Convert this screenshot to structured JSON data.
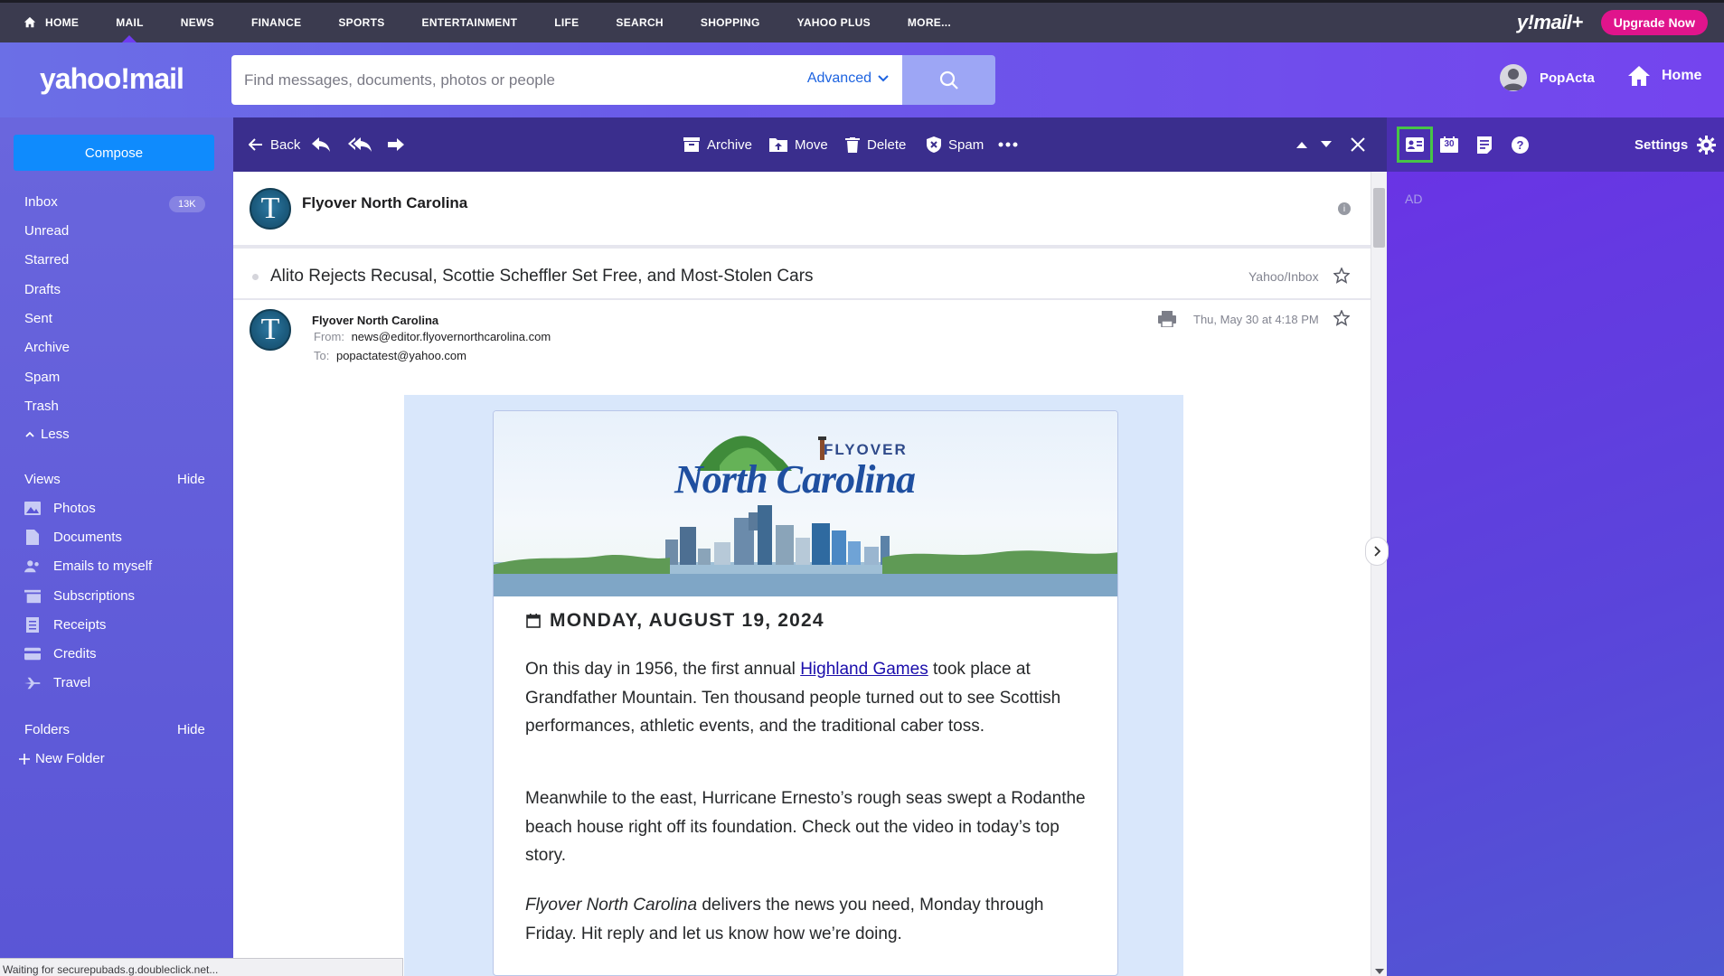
{
  "topnav": {
    "items": [
      {
        "label": "HOME",
        "icon": "home-icon"
      },
      {
        "label": "MAIL",
        "active": true
      },
      {
        "label": "NEWS"
      },
      {
        "label": "FINANCE"
      },
      {
        "label": "SPORTS"
      },
      {
        "label": "ENTERTAINMENT"
      },
      {
        "label": "LIFE"
      },
      {
        "label": "SEARCH"
      },
      {
        "label": "SHOPPING"
      },
      {
        "label": "YAHOO PLUS"
      },
      {
        "label": "MORE..."
      }
    ],
    "mailplus_logo": "y!mail+",
    "upgrade_label": "Upgrade Now"
  },
  "header": {
    "logo": "yahoo!mail",
    "search_placeholder": "Find messages, documents, photos or people",
    "advanced_label": "Advanced",
    "user_name": "PopActa",
    "home_label": "Home"
  },
  "sidebar": {
    "compose_label": "Compose",
    "folders": [
      {
        "label": "Inbox",
        "badge": "13K"
      },
      {
        "label": "Unread"
      },
      {
        "label": "Starred"
      },
      {
        "label": "Drafts"
      },
      {
        "label": "Sent"
      },
      {
        "label": "Archive"
      },
      {
        "label": "Spam"
      },
      {
        "label": "Trash"
      }
    ],
    "less_label": "Less",
    "views_label": "Views",
    "views_hide": "Hide",
    "views": [
      {
        "label": "Photos",
        "icon": "photo-icon"
      },
      {
        "label": "Documents",
        "icon": "document-icon"
      },
      {
        "label": "Emails to myself",
        "icon": "people-icon"
      },
      {
        "label": "Subscriptions",
        "icon": "subscriptions-icon"
      },
      {
        "label": "Receipts",
        "icon": "receipt-icon"
      },
      {
        "label": "Credits",
        "icon": "credit-card-icon"
      },
      {
        "label": "Travel",
        "icon": "plane-icon"
      }
    ],
    "folders_label": "Folders",
    "folders_hide": "Hide",
    "new_folder_label": "New Folder"
  },
  "toolbar": {
    "back_label": "Back",
    "archive_label": "Archive",
    "move_label": "Move",
    "delete_label": "Delete",
    "spam_label": "Spam"
  },
  "right_panel": {
    "calendar_day": "30",
    "settings_label": "Settings",
    "ad_label": "AD"
  },
  "message": {
    "sender": "Flyover North Carolina",
    "avatar_letter": "T",
    "subject": "Alito Rejects Recusal, Scottie Scheffler Set Free, and Most-Stolen Cars",
    "folder": "Yahoo/Inbox",
    "from_label": "From:",
    "from_address": "news@editor.flyovernorthcarolina.com",
    "to_label": "To:",
    "to_address": "popactatest@yahoo.com",
    "date": "Thu, May 30 at 4:18 PM"
  },
  "newsletter": {
    "brand_top": "FLYOVER",
    "brand_main": "North Carolina",
    "date_heading": "MONDAY, AUGUST 19, 2024",
    "para1_pre": "On this day in 1956, the first annual ",
    "para1_link": "Highland Games",
    "para1_post": " took place at Grandfather Mountain. Ten thousand people turned out to see Scottish performances, athletic events, and the traditional caber toss.",
    "para2": "Meanwhile to the east, Hurricane Ernesto’s rough seas swept a Rodanthe beach house right off its foundation. Check out the video in today’s top story.",
    "para3_em": "Flyover North Carolina",
    "para3_post": " delivers the news you need, Monday through Friday. Hit reply and let us know how we’re doing."
  },
  "statusbar": {
    "text": "Waiting for securepubads.g.doubleclick.net..."
  },
  "colors": {
    "accent": "#0f8bfd",
    "upgrade": "#e0148c",
    "toolbar": "#3a2e8d",
    "selection_outline": "#47c447"
  }
}
